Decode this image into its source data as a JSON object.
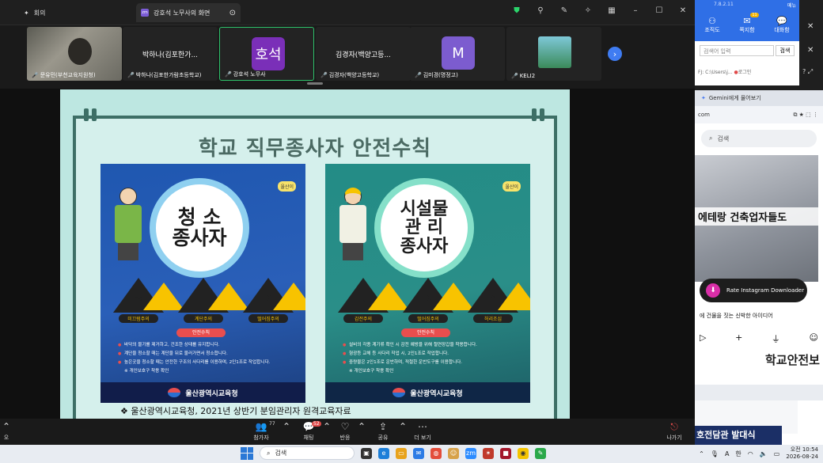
{
  "zoom": {
    "tabs": {
      "meeting": "회의",
      "share": "강호석 노무사의 화면"
    },
    "participants": [
      {
        "name": "문유민(부천교육지원청)",
        "type": "video"
      },
      {
        "name": "박하나(김포한가람초등학교)",
        "display": "박하나(김포한가...",
        "type": "name"
      },
      {
        "name": "강호석 노무사",
        "avatar": "호석",
        "color": "#7a2fb8",
        "type": "avatar",
        "active": true
      },
      {
        "name": "김경자(백양고등학교)",
        "display": "김경자(백양고등...",
        "type": "name"
      },
      {
        "name": "김미경(명정고)",
        "avatar": "M",
        "color": "#7c5ccf",
        "type": "avatar"
      },
      {
        "name": "KELI2",
        "type": "thumb"
      }
    ],
    "slide": {
      "title": "학교 직무종사자 안전수칙",
      "left": {
        "circle_text": "청  소\n종사자",
        "logo": "울산이",
        "signs": [
          "미끄럼주의",
          "계단주의",
          "떨어짐주의"
        ],
        "rules_tag": "안전수칙",
        "rules": [
          "바닥의 물기를 제거하고, 건조한 상태를 유지합니다.",
          "계단을 청소할 때는 계단을 뒤로 물러가면서 청소합니다.",
          "높은곳을 청소할 때는 안전한 구조의 사다리를 이용하며, 2인1조로 작업합니다."
        ],
        "note": "※ 개인보호구 착용 확인",
        "footer": "울산광역시교육청"
      },
      "right": {
        "circle_text": "시설물\n관  리\n종사자",
        "logo": "울산이",
        "signs": [
          "감전주의",
          "떨어짐주의",
          "허리조심"
        ],
        "rules_tag": "안전수칙",
        "rules": [
          "설비의 각종 계기류 확인 시 감전 예방을 위해 절연장갑을 착용합니다.",
          "형광등 교체 등 사다리 작업 시, 2인1조로 작업합니다.",
          "중량물은 2인1조로 운반하며, 적절한 운반도구를 이용합니다."
        ],
        "note": "※ 개인보호구 착용 확인",
        "footer": "울산광역시교육청"
      },
      "caption": "❖  울산광역시교육청, 2021년 상반기 분임관리자 원격교육자료"
    },
    "controls": {
      "participants": {
        "label": "참가자",
        "count": "77"
      },
      "chat": {
        "label": "채팅",
        "badge": "52"
      },
      "react": {
        "label": "반응"
      },
      "share": {
        "label": "공유"
      },
      "more": {
        "label": "더 보기"
      },
      "leave": {
        "label": "나가기"
      },
      "left_edge": "오"
    }
  },
  "side_app": {
    "version": "7.8.2.11",
    "menu": "메뉴",
    "tabs": [
      "조직도",
      "쪽지함",
      "대화함"
    ],
    "tab_badge": "11",
    "search_placeholder": "검색어 입력",
    "search_button": "검색",
    "nav_text": "FJ: C:\\Users\\j...",
    "login": "로그인"
  },
  "browser": {
    "tab_title": "Gemini에게 물어보기",
    "url": "com",
    "search": "검색",
    "image_text": "에테랑 건축업자들도",
    "insta_label": "Rate Instagram Downloader",
    "caption": "에 건물을 짓는 신박한 아이디어",
    "thumb_text": "학교안전보",
    "banner": "호전담관 발대식"
  },
  "taskbar": {
    "search": "검색",
    "time": "오전 10:54",
    "date": "2026-08-24",
    "lang": "한"
  }
}
